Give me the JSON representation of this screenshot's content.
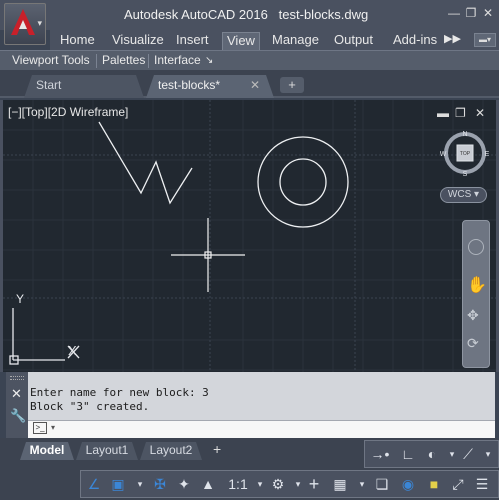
{
  "titlebar": {
    "app": "Autodesk AutoCAD 2016",
    "filename": "test-blocks.dwg"
  },
  "ribbon": {
    "tabs": [
      "Home",
      "Visualize",
      "Insert",
      "View",
      "Manage",
      "Output",
      "Add-ins"
    ],
    "active_tab": "View"
  },
  "panels": {
    "items": [
      "Viewport Tools",
      "Palettes",
      "Interface"
    ]
  },
  "doc_tabs": {
    "start": "Start",
    "active": "test-blocks*"
  },
  "viewport": {
    "label": "[−][Top][2D Wireframe]",
    "viewcube_face": "TOP",
    "compass": {
      "n": "N",
      "s": "S",
      "e": "E",
      "w": "W"
    },
    "wcs": "WCS",
    "ucs": {
      "y": "Y",
      "x": "X"
    }
  },
  "command": {
    "line1": "Enter name for new block: 3",
    "line2": "Block \"3\" created.",
    "prompt_icon": ">_"
  },
  "layout_tabs": {
    "model": "Model",
    "layout1": "Layout1",
    "layout2": "Layout2",
    "plus": "+"
  },
  "statusbar": {
    "scale": "1:1"
  },
  "colors": {
    "canvas": "#212830",
    "accent_blue": "#3b86d6",
    "autocad_red": "#c8202a"
  }
}
